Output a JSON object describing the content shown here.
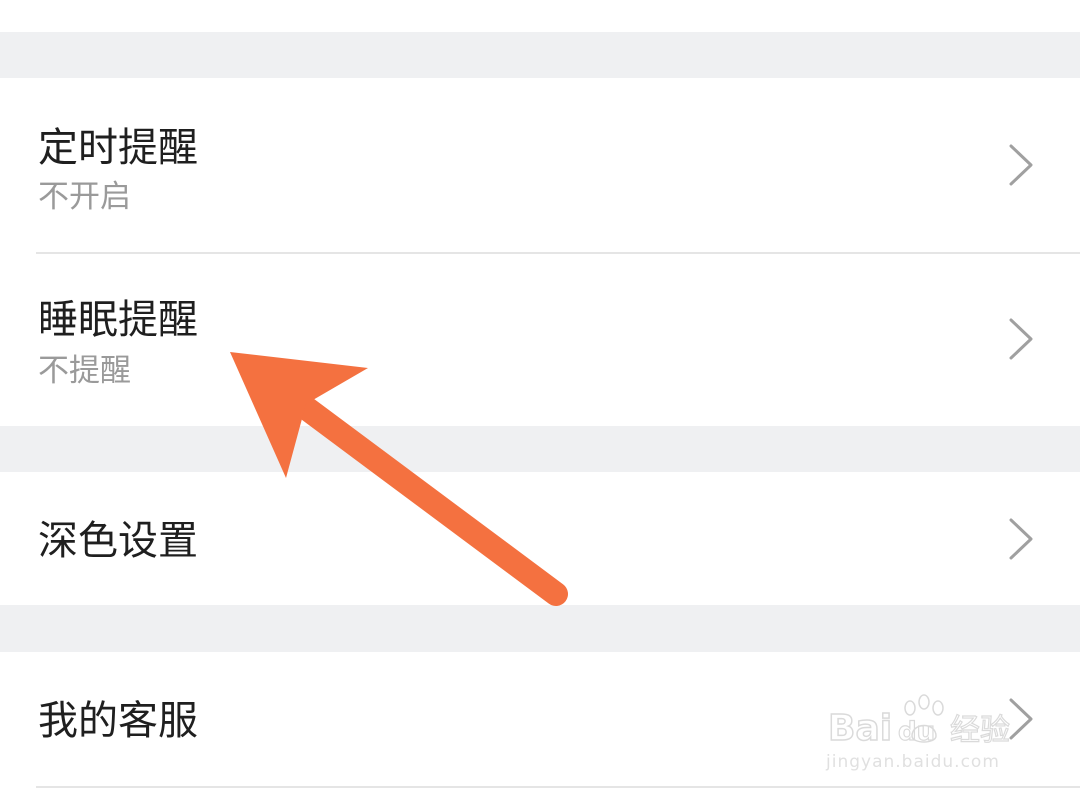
{
  "settings": {
    "items": [
      {
        "title": "定时提醒",
        "subtitle": "不开启"
      },
      {
        "title": "睡眠提醒",
        "subtitle": "不提醒"
      },
      {
        "title": "深色设置"
      },
      {
        "title": "我的客服"
      }
    ]
  },
  "icons": {
    "chevron": "chevron-right-icon",
    "annotation": "orange-arrow-pointer",
    "watermark_logo": "baidu-paw-logo"
  },
  "watermark": {
    "brand": "Bai",
    "brand2": "du",
    "brand3": "经验",
    "url": "jingyan.baidu.com"
  },
  "colors": {
    "background": "#ffffff",
    "section_gap": "#eff0f2",
    "title_text": "#1f1f1f",
    "subtitle_text": "#9a9a9a",
    "chevron": "#a0a0a0",
    "arrow": "#f47140"
  }
}
